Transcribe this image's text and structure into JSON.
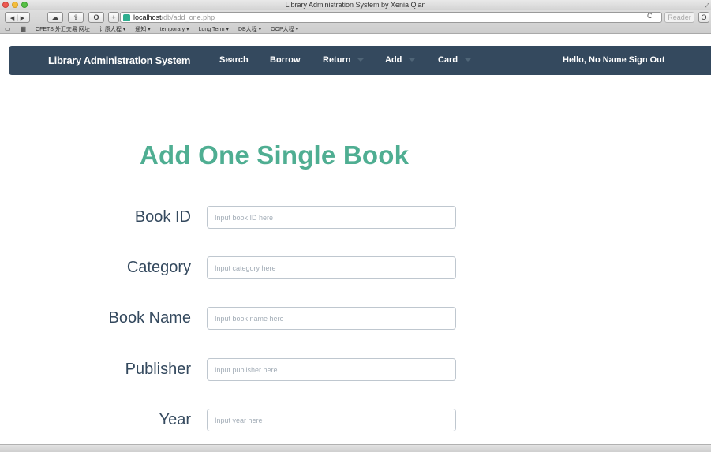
{
  "window": {
    "title": "Library Administration System by Xenia Qian"
  },
  "browser": {
    "url_host": "localhost",
    "url_path": "/db/add_one.php",
    "reload_glyph": "C",
    "reader_label": "Reader",
    "nav_back": "◀",
    "nav_forward": "▶",
    "cloud_glyph": "☁",
    "share_glyph": "⇪",
    "ext_glyph": "O",
    "add_tab_glyph": "+",
    "bookmarks": [
      "CFETS 外汇交易 网址",
      "计原大程 ▾",
      "通知 ▾",
      "temporary ▾",
      "Long Term ▾",
      "DB大程 ▾",
      "OOP大程 ▾"
    ]
  },
  "navbar": {
    "brand": "Library Administration System",
    "items": [
      {
        "label": "Search"
      },
      {
        "label": "Borrow"
      },
      {
        "label": "Return"
      },
      {
        "label": "Add"
      },
      {
        "label": "Card"
      }
    ],
    "user_text": "Hello, No Name Sign Out",
    "bg_color": "#34495e"
  },
  "main": {
    "title": "Add One Single Book",
    "title_color": "#4fae92",
    "fields": [
      {
        "label": "Book ID",
        "placeholder": "Input book ID here",
        "value": ""
      },
      {
        "label": "Category",
        "placeholder": "Input category here",
        "value": ""
      },
      {
        "label": "Book Name",
        "placeholder": "Input book name here",
        "value": ""
      },
      {
        "label": "Publisher",
        "placeholder": "Input publisher here",
        "value": ""
      },
      {
        "label": "Year",
        "placeholder": "Input year here",
        "value": ""
      }
    ]
  }
}
